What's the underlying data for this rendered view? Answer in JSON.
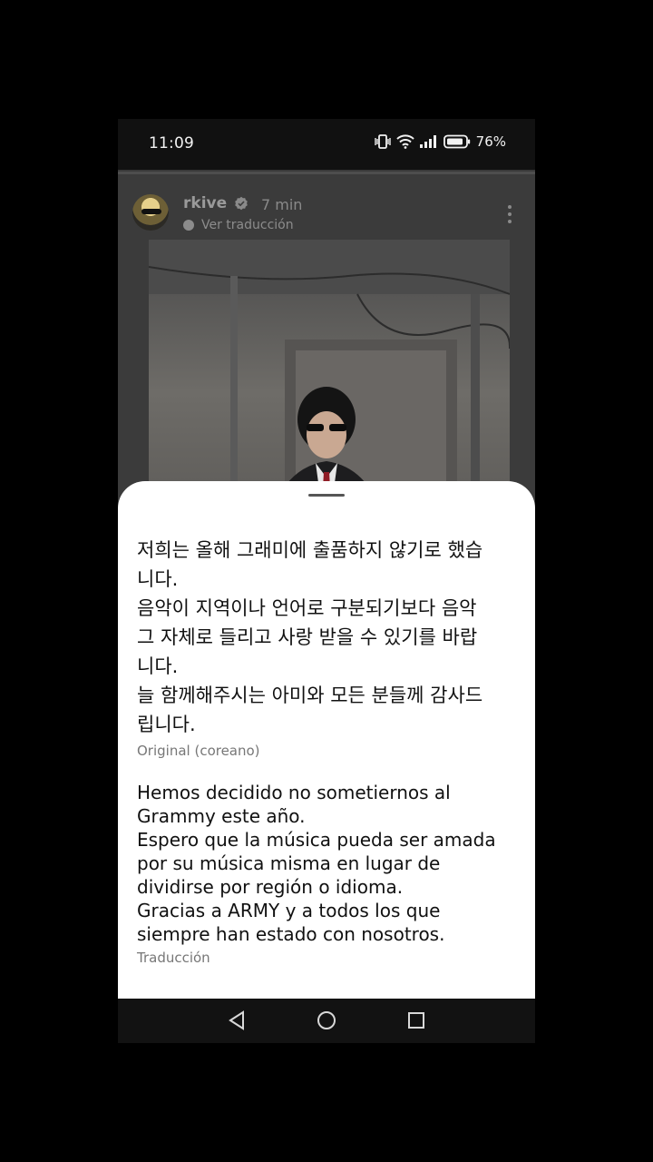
{
  "status_bar": {
    "time": "11:09",
    "battery": "76%",
    "icons": [
      "vibrate-icon",
      "wifi-icon",
      "signal-icon",
      "battery-icon"
    ]
  },
  "post": {
    "username": "rkive",
    "time_ago": "7 min",
    "translate_link": "Ver traducción",
    "icons": [
      "verified-icon",
      "globe-icon",
      "more-vert-icon"
    ]
  },
  "sheet": {
    "original_text": "저희는 올해 그래미에 출품하지 않기로 했습\n니다.\n음악이 지역이나 언어로 구분되기보다 음악\n그 자체로 들리고 사랑 받을 수 있기를 바랍\n니다.\n늘 함께해주시는 아미와 모든 분들께 감사드\n립니다.",
    "original_label": "Original (coreano)",
    "translated_text": "Hemos decidido no sometiernos al\nGrammy este año.\nEspero que la música pueda ser amada\npor su música misma en lugar de\ndividirse por región o idioma.\nGracias a ARMY y a todos los que\nsiempre han estado con nosotros.",
    "translated_label": "Traducción"
  },
  "nav": {
    "icons": [
      "back-icon",
      "home-icon",
      "recents-icon"
    ]
  },
  "colors": {
    "background": "#000000",
    "sheet": "#ffffff",
    "post_bg": "#3b3b3b",
    "muted_text": "#777777"
  }
}
